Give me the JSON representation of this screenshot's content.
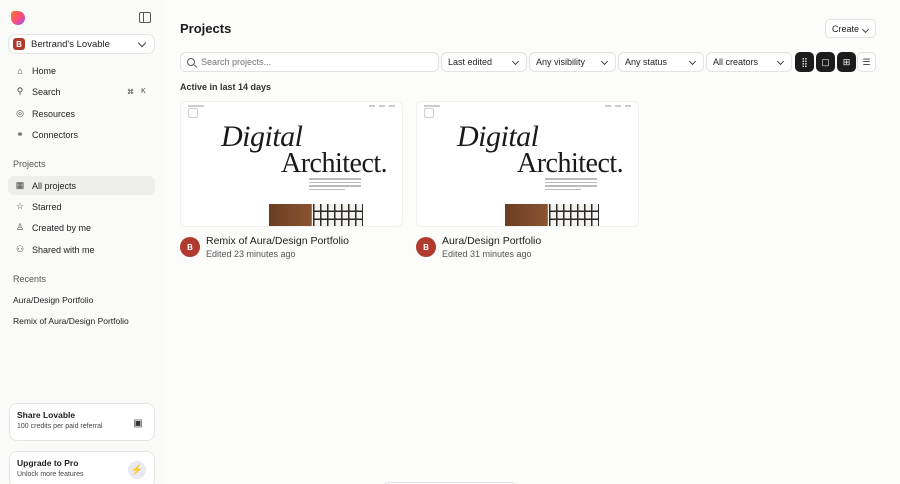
{
  "sidebar": {
    "workspace": {
      "badge": "B",
      "name": "Bertrand's Lovable"
    },
    "nav": [
      {
        "label": "Home",
        "icon": "home-icon"
      },
      {
        "label": "Search",
        "icon": "search-icon",
        "shortcut": [
          "⌘",
          "K"
        ]
      },
      {
        "label": "Resources",
        "icon": "compass-icon"
      },
      {
        "label": "Connectors",
        "icon": "connectors-icon"
      }
    ],
    "projects_section": {
      "label": "Projects",
      "items": [
        {
          "label": "All projects",
          "icon": "grid-icon",
          "active": true
        },
        {
          "label": "Starred",
          "icon": "star-icon"
        },
        {
          "label": "Created by me",
          "icon": "user-icon"
        },
        {
          "label": "Shared with me",
          "icon": "users-icon"
        }
      ]
    },
    "recents": {
      "label": "Recents",
      "items": [
        "Aura/Design Portfolio",
        "Remix of Aura/Design Portfolio"
      ]
    },
    "share_card": {
      "title": "Share Lovable",
      "subtitle": "100 credits per paid referral",
      "icon": "gift-icon"
    },
    "upgrade_card": {
      "title": "Upgrade to Pro",
      "subtitle": "Unlock more features",
      "icon": "bolt-icon"
    }
  },
  "main": {
    "title": "Projects",
    "create_label": "Create",
    "search_placeholder": "Search projects...",
    "filters": [
      "Last edited",
      "Any visibility",
      "Any status",
      "All creators"
    ],
    "view_options": [
      "grid-large-icon",
      "grid-single-icon",
      "grid-small-icon",
      "list-icon"
    ],
    "active_label": "Active in last 14 days",
    "projects": [
      {
        "name": "Remix of Aura/Design Portfolio",
        "edited": "Edited 23 minutes ago",
        "avatar": "B",
        "thumb_line1": "Digital",
        "thumb_line2": "Architect."
      },
      {
        "name": "Aura/Design Portfolio",
        "edited": "Edited 31 minutes ago",
        "avatar": "B",
        "thumb_line1": "Digital",
        "thumb_line2": "Architect."
      }
    ]
  },
  "colors": {
    "accent": "#b03a2e",
    "dark_button": "#1c1c1c"
  }
}
